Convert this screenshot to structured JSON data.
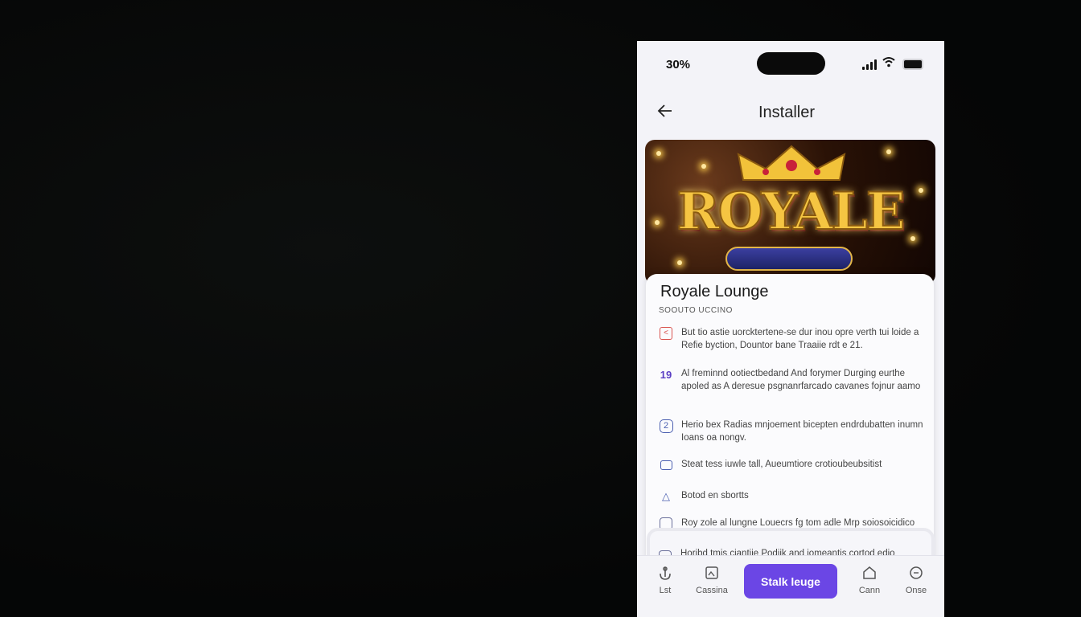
{
  "status_bar": {
    "time": "30%"
  },
  "header": {
    "title": "Installer"
  },
  "banner": {
    "logo_text": "ROYALE"
  },
  "app": {
    "name": "Royale Lounge",
    "subtitle": "SOOUTO UCCINO"
  },
  "features": [
    {
      "icon": "share-icon",
      "text": "But tio astie uorcktertene-se dur inou opre verth tui loide a Refie byction, Dountor bane Traaiie rdt e 21."
    },
    {
      "icon": "number-19-icon",
      "text": "Al freminnd ootiectbedand And forymer Durging eurthe apoled as A deresue psgnanrfarcado cavanes fojnur aamo"
    },
    {
      "icon": "number-2-icon",
      "text": "Herio bex Radias mnjoement bicepten endrdubatten inumn Ioans oa nongv."
    },
    {
      "icon": "chat-icon",
      "text": "Steat tess iuwle tall, Aueumtiore crotioubeubsitist"
    },
    {
      "icon": "triangle-icon",
      "text": "Botod en sbortts"
    },
    {
      "icon": "square-icon",
      "text": "Roy zole al lungne Louecrs fg tom adle Mrp soiosoicidico"
    },
    {
      "icon": "square-icon",
      "text": "Horibd tmis ciantiie Podiik and iomeantis cortod edio"
    }
  ],
  "tabbar": {
    "tabs": [
      {
        "icon": "anchor-icon",
        "label": "Lst"
      },
      {
        "icon": "image-icon",
        "label": "Cassina"
      },
      {
        "icon": "home-icon",
        "label": "Cann"
      },
      {
        "icon": "chat-icon",
        "label": "Onse"
      }
    ],
    "cta_label": "Stalk leuge"
  },
  "colors": {
    "accent": "#6b46e5",
    "background": "#070808",
    "panel": "#f3f3f8"
  }
}
